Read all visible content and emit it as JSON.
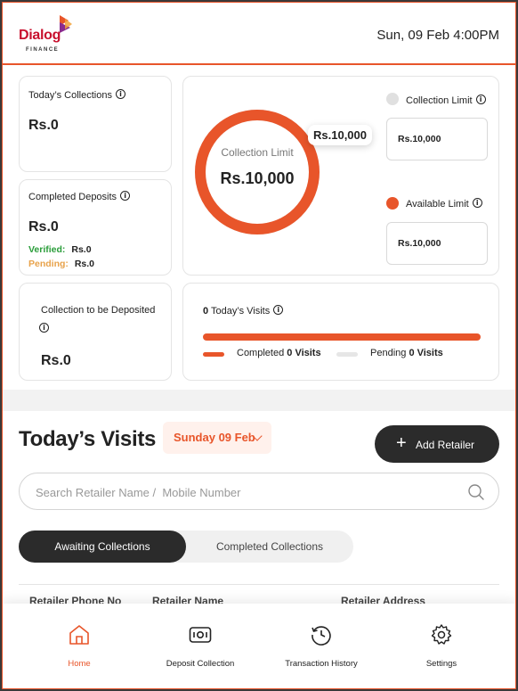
{
  "brand": {
    "name": "Dialog",
    "subname": "FINANCE"
  },
  "header": {
    "datetime": "Sun, 09 Feb 4:00PM"
  },
  "todays_collections": {
    "title": "Today’s Collections",
    "amount": "Rs.0"
  },
  "completed_deposits": {
    "title": "Completed Deposits",
    "amount": "Rs.0",
    "verified_label": "Verified:",
    "verified_value": "Rs.0",
    "pending_label": "Pending:",
    "pending_value": "Rs.0"
  },
  "to_be_deposited": {
    "title": "Collection to be Deposited",
    "amount": "Rs.0"
  },
  "limit": {
    "ring_label": "Collection Limit",
    "ring_value": "Rs.10,000",
    "badge": "Rs.10,000",
    "available_fraction": 1.0,
    "collection_limit_label": "Collection Limit",
    "collection_limit_value": "Rs.10,000",
    "available_limit_label": "Available Limit",
    "available_limit_value": "Rs.10,000",
    "colors": {
      "available": "#e8552a",
      "used": "#e0e0e0"
    }
  },
  "visits_summary": {
    "count": "0",
    "label": "Today’s Visits",
    "completed_fraction": 0,
    "completed_label": "Completed",
    "completed_value": "0 Visits",
    "pending_label": "Pending",
    "pending_value": "0 Visits"
  },
  "visits": {
    "title": "Today’s Visits",
    "date_filter": "Sunday 09 Feb",
    "add_button": "Add Retailer",
    "search_placeholder": "Search Retailer Name /  Mobile Number",
    "tabs": [
      {
        "label": "Awaiting Collections",
        "active": true
      },
      {
        "label": "Completed Collections",
        "active": false
      }
    ],
    "columns": [
      "Retailer Phone No",
      "Retailer Name",
      "Retailer Address"
    ]
  },
  "nav": [
    {
      "label": "Home",
      "icon": "home-icon",
      "active": true
    },
    {
      "label": "Deposit Collection",
      "icon": "cash-icon",
      "active": false
    },
    {
      "label": "Transaction History",
      "icon": "history-icon",
      "active": false
    },
    {
      "label": "Settings",
      "icon": "gear-icon",
      "active": false
    }
  ],
  "colors": {
    "accent": "#e8552a",
    "dark": "#2b2b2b",
    "verified": "#2a9d3a",
    "pending": "#e8a24a"
  }
}
